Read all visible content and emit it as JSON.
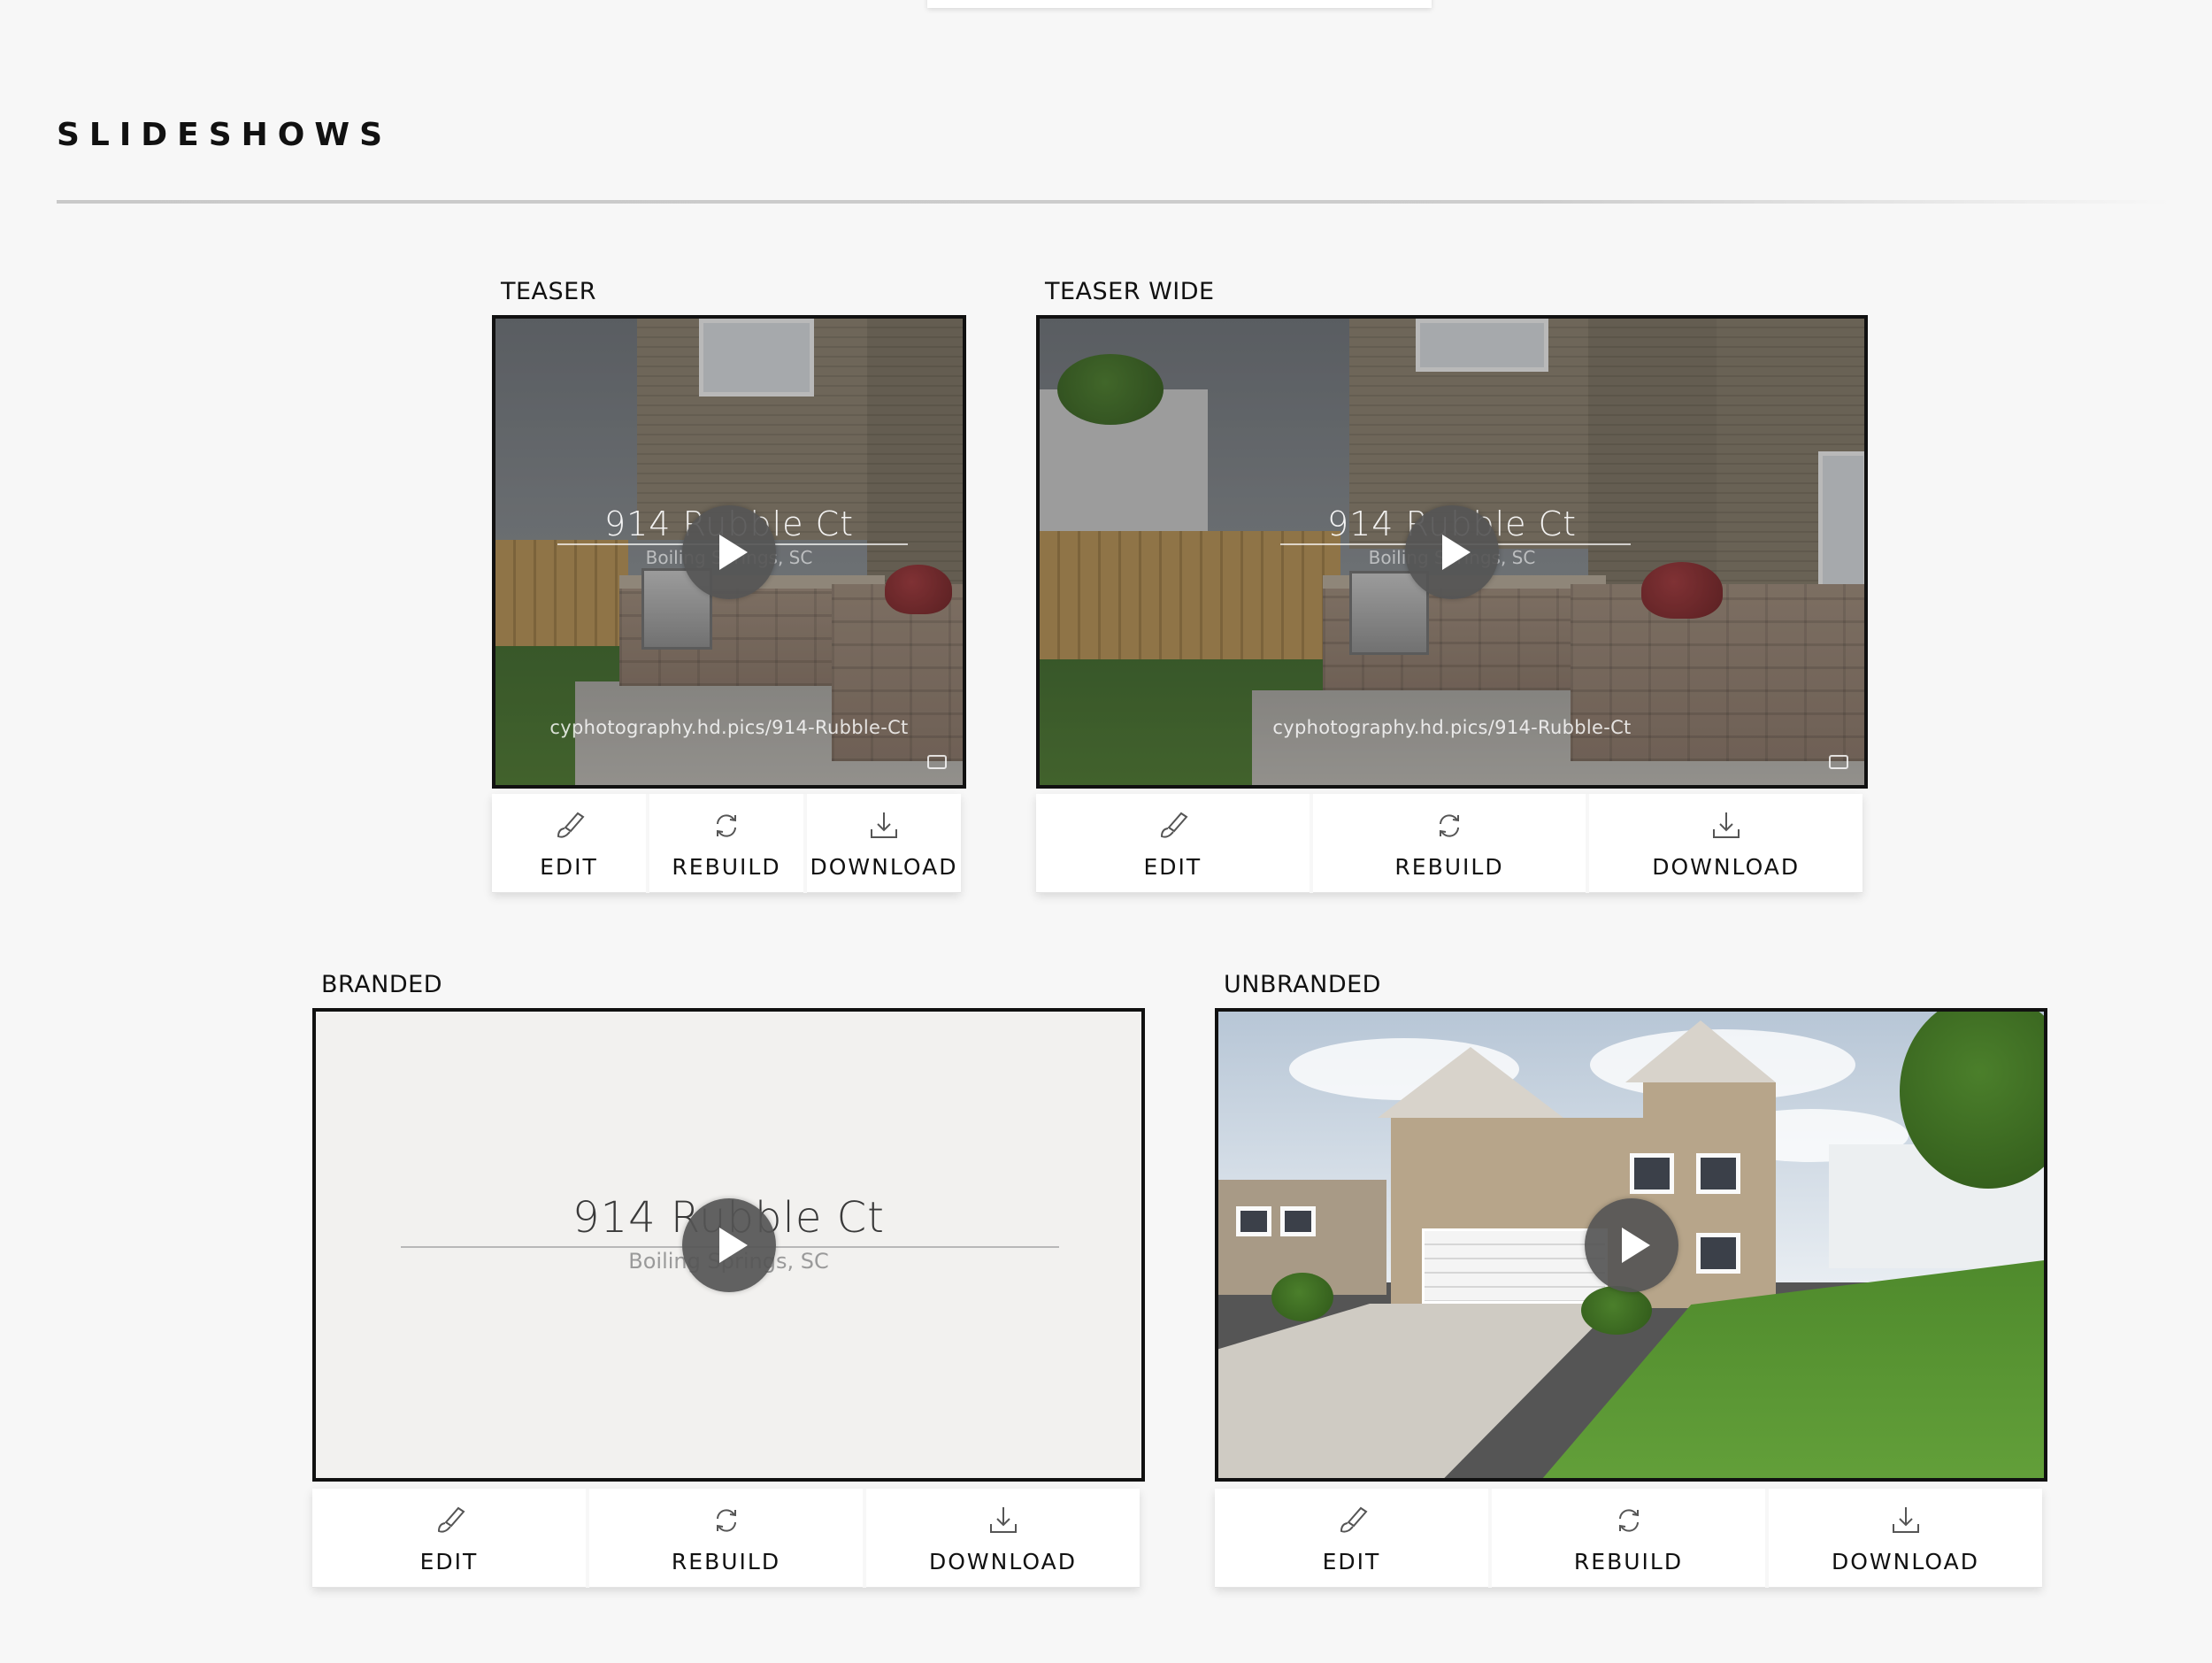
{
  "section": {
    "title": "SLIDESHOWS"
  },
  "actions": {
    "edit": "EDIT",
    "rebuild": "REBUILD",
    "download": "DOWNLOAD"
  },
  "overlay": {
    "address": "914 Rubble Ct",
    "city": "Boiling Springs, SC",
    "url": "cyphotography.hd.pics/914-Rubble-Ct"
  },
  "cards": [
    {
      "label": "TEASER"
    },
    {
      "label": "TEASER WIDE"
    },
    {
      "label": "BRANDED"
    },
    {
      "label": "UNBRANDED"
    }
  ],
  "icons": [
    "brush-icon",
    "refresh-icon",
    "download-icon",
    "play-icon",
    "camera-icon"
  ],
  "colors": {
    "background": "#f7f7f7",
    "frame": "#111111",
    "play": "#555555",
    "branded_bg": "#f2f1ef"
  }
}
